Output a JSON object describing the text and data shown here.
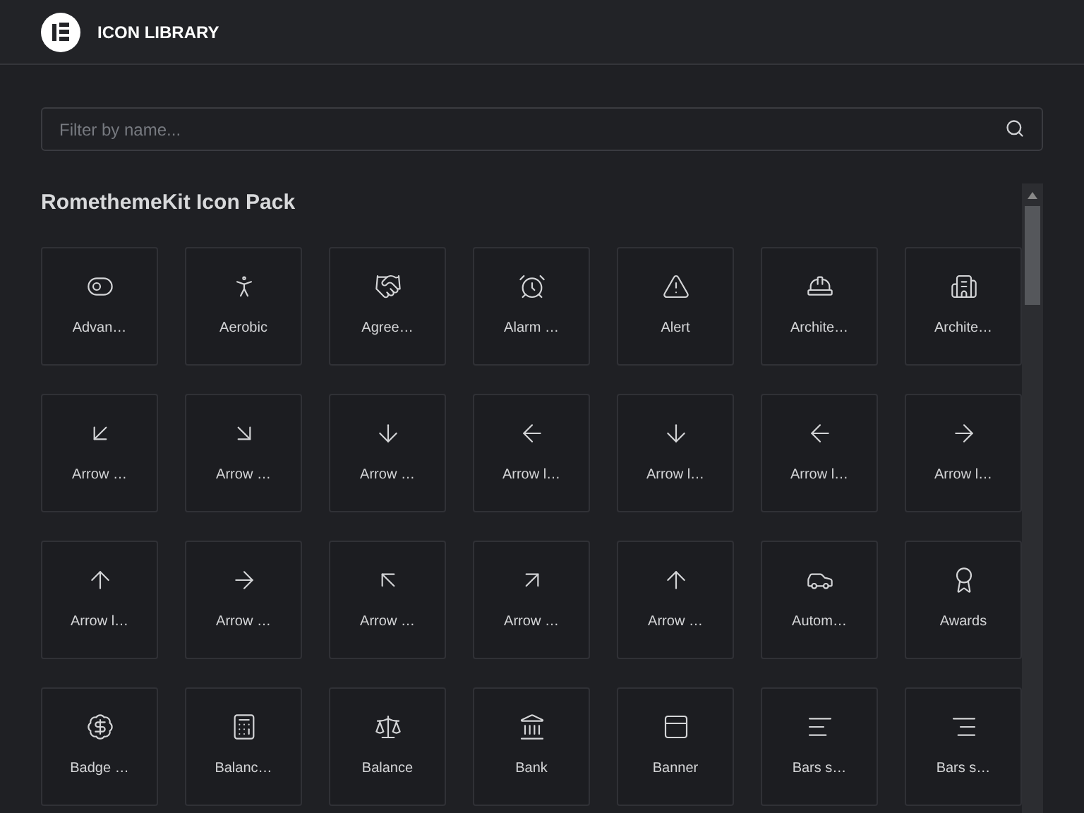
{
  "header": {
    "title": "ICON LIBRARY"
  },
  "search": {
    "placeholder": "Filter by name..."
  },
  "pack": {
    "title": "RomethemeKit Icon Pack"
  },
  "icons": [
    {
      "label": "Advan…"
    },
    {
      "label": "Aerobic"
    },
    {
      "label": "Agree…"
    },
    {
      "label": "Alarm …"
    },
    {
      "label": "Alert"
    },
    {
      "label": "Archite…"
    },
    {
      "label": "Archite…"
    },
    {
      "label": "Arrow …"
    },
    {
      "label": "Arrow …"
    },
    {
      "label": "Arrow …"
    },
    {
      "label": "Arrow l…"
    },
    {
      "label": "Arrow l…"
    },
    {
      "label": "Arrow l…"
    },
    {
      "label": "Arrow l…"
    },
    {
      "label": "Arrow l…"
    },
    {
      "label": "Arrow …"
    },
    {
      "label": "Arrow …"
    },
    {
      "label": "Arrow …"
    },
    {
      "label": "Arrow …"
    },
    {
      "label": "Autom…"
    },
    {
      "label": "Awards"
    },
    {
      "label": "Badge …"
    },
    {
      "label": "Balanc…"
    },
    {
      "label": "Balance"
    },
    {
      "label": "Bank"
    },
    {
      "label": "Banner"
    },
    {
      "label": "Bars s…"
    },
    {
      "label": "Bars s…"
    }
  ]
}
